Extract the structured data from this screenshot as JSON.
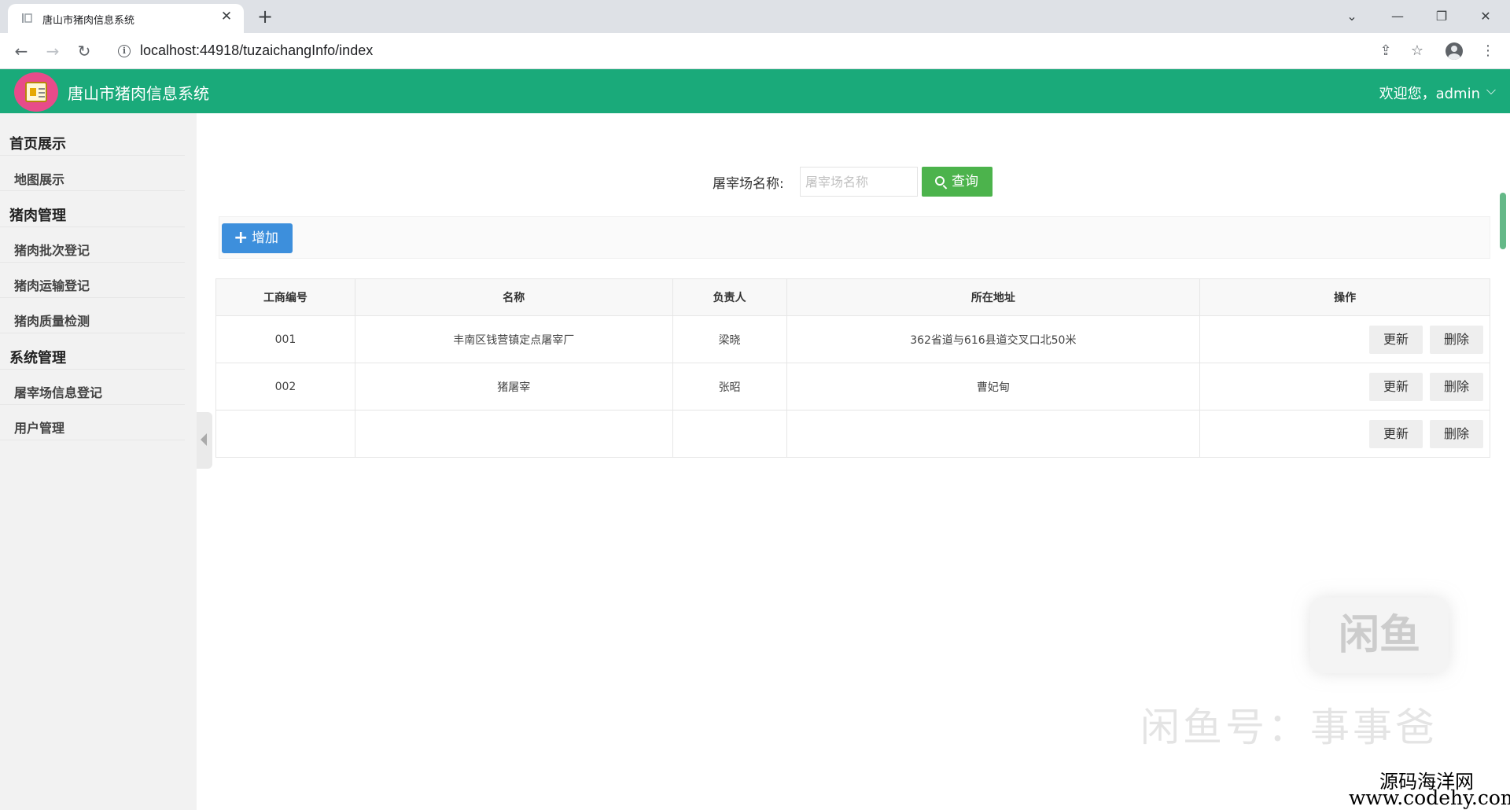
{
  "browser": {
    "tab_title": "唐山市猪肉信息系统",
    "url": "localhost:44918/tuzaichangInfo/index"
  },
  "app": {
    "title": "唐山市猪肉信息系统",
    "welcome": "欢迎您，admin",
    "header_color": "#1aaa7a"
  },
  "sidebar": {
    "groups": [
      {
        "title": "首页展示",
        "items": [
          "地图展示"
        ]
      },
      {
        "title": "猪肉管理",
        "items": [
          "猪肉批次登记",
          "猪肉运输登记",
          "猪肉质量检测"
        ]
      },
      {
        "title": "系统管理",
        "items": [
          "屠宰场信息登记",
          "用户管理"
        ]
      }
    ]
  },
  "search": {
    "label": "屠宰场名称:",
    "placeholder": "屠宰场名称",
    "button": "查询"
  },
  "toolbar": {
    "add_label": "增加"
  },
  "table": {
    "headers": [
      "工商编号",
      "名称",
      "负责人",
      "所在地址",
      "操作"
    ],
    "rows": [
      {
        "code": "001",
        "name": "丰南区钱营镇定点屠宰厂",
        "manager": "梁晓",
        "address": "362省道与616县道交叉口北50米"
      },
      {
        "code": "002",
        "name": "猪屠宰",
        "manager": "张昭",
        "address": "曹妃甸"
      },
      {
        "code": "",
        "name": "",
        "manager": "",
        "address": ""
      }
    ],
    "update_label": "更新",
    "delete_label": "删除"
  },
  "watermark": {
    "logo": "闲鱼",
    "text": "闲鱼号：事事爸",
    "site_name": "源码海洋网",
    "site_url": "www.codehy.com"
  }
}
